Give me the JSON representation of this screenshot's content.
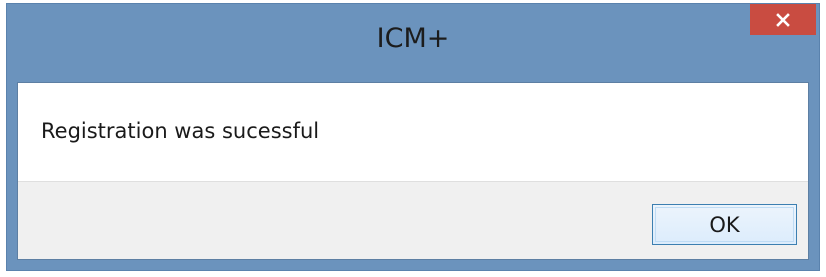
{
  "window": {
    "title": "ICM+",
    "close_icon": "close-icon",
    "frame_color": "#6b93bd",
    "close_color": "#c94c41"
  },
  "dialog": {
    "message": "Registration was sucessful",
    "ok_label": "OK"
  }
}
